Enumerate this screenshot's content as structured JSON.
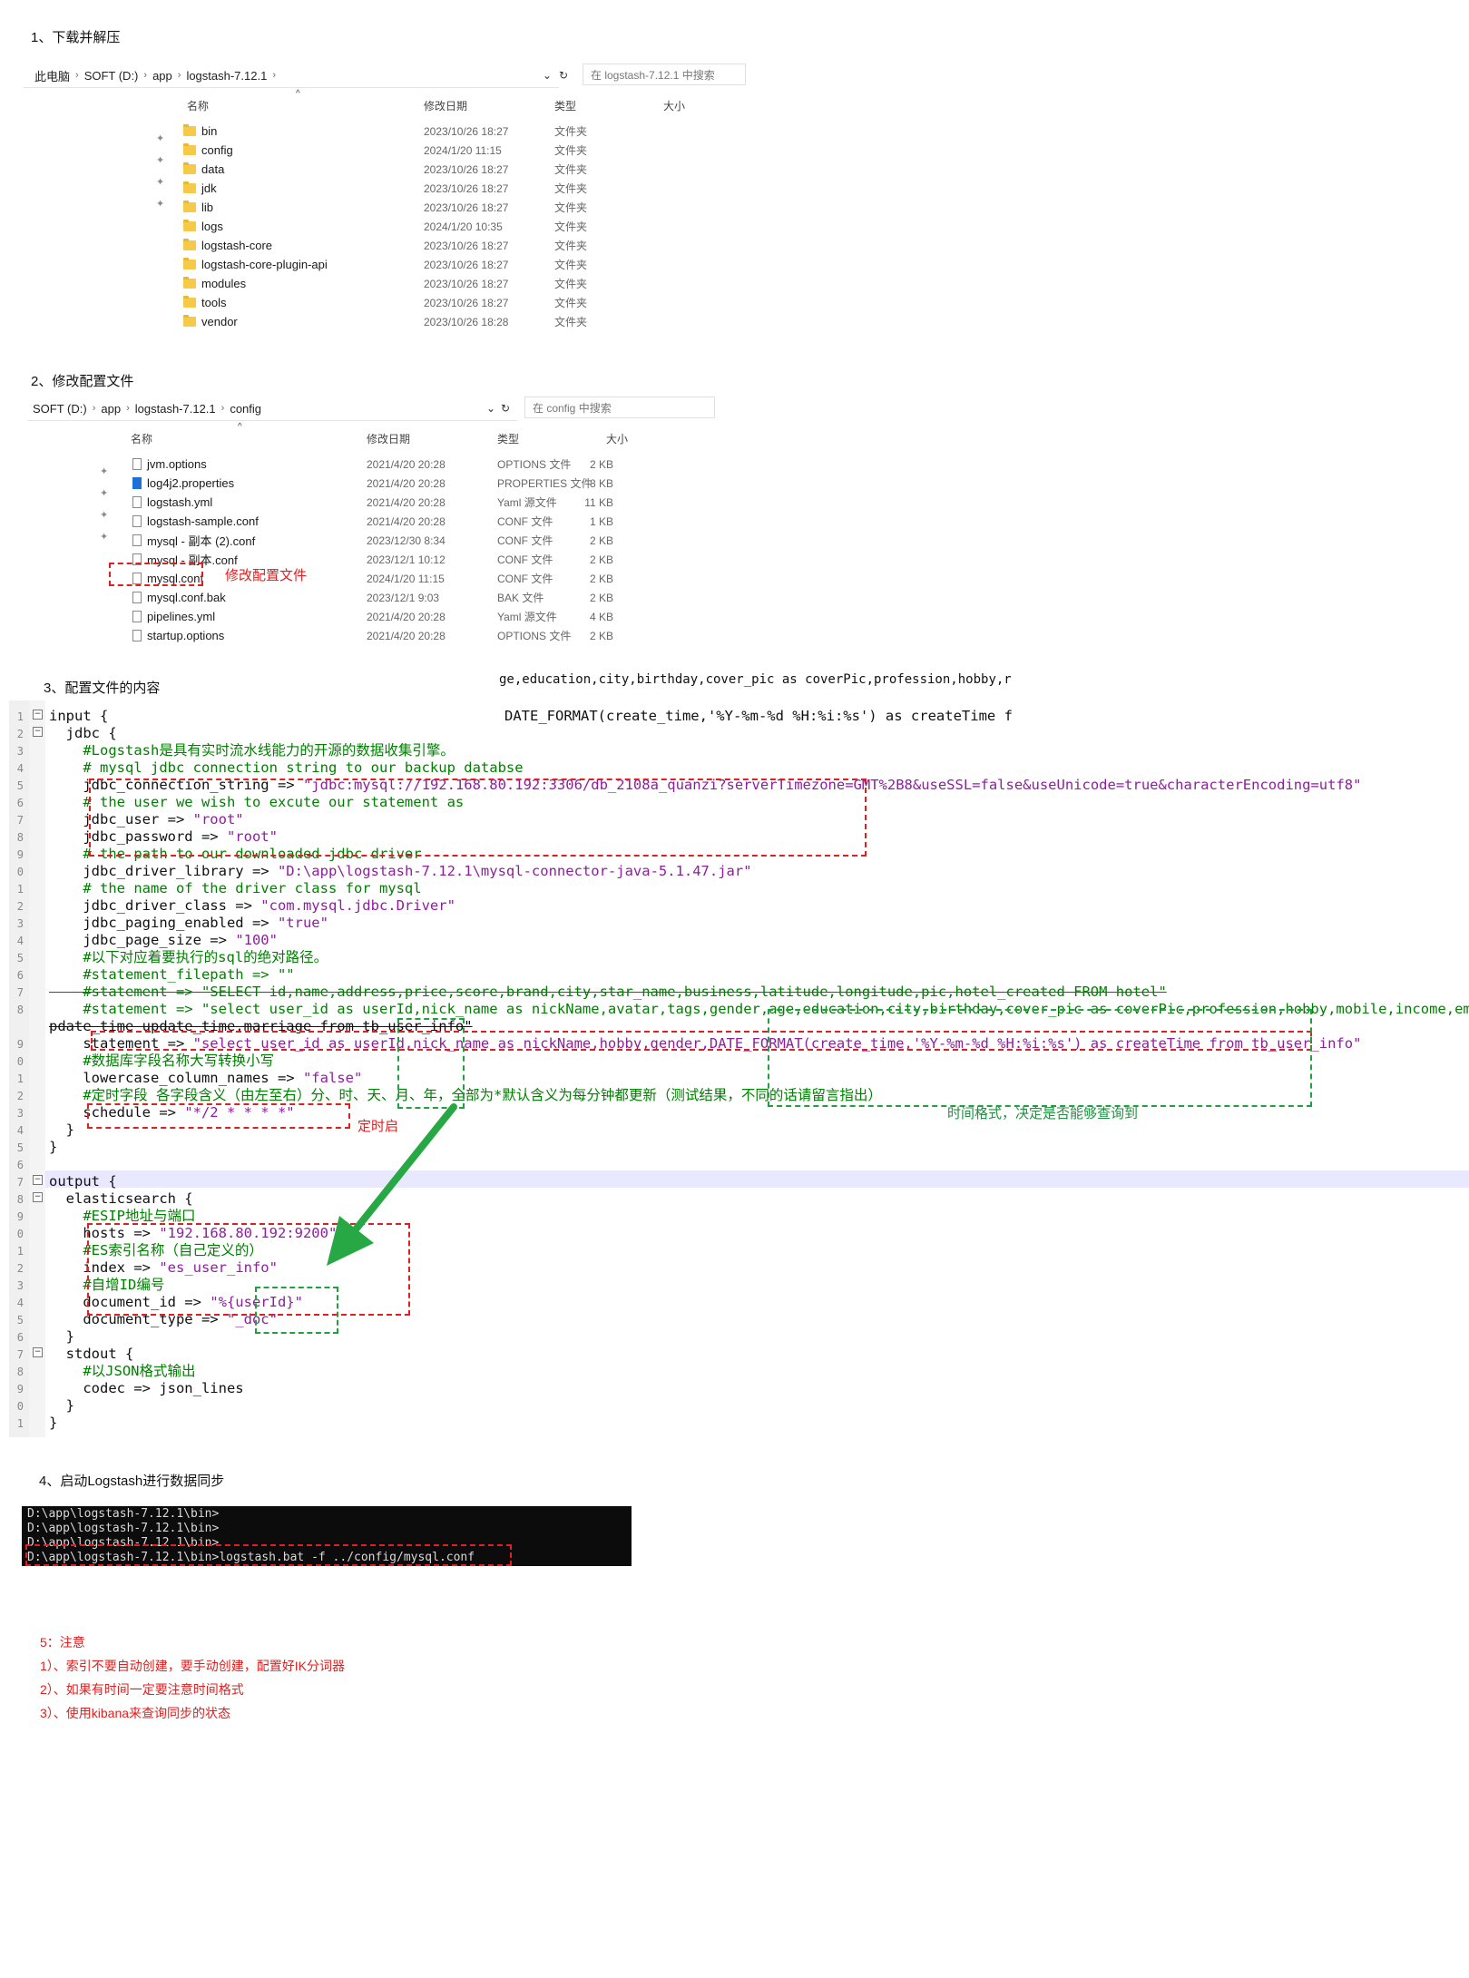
{
  "step1": {
    "heading": "1、下载并解压",
    "breadcrumb": [
      "此电脑",
      "SOFT (D:)",
      "app",
      "logstash-7.12.1"
    ],
    "search_placeholder": "在 logstash-7.12.1 中搜索",
    "columns": {
      "name": "名称",
      "date": "修改日期",
      "type": "类型",
      "size": "大小"
    },
    "rows": [
      {
        "name": "bin",
        "date": "2023/10/26 18:27",
        "type": "文件夹"
      },
      {
        "name": "config",
        "date": "2024/1/20 11:15",
        "type": "文件夹"
      },
      {
        "name": "data",
        "date": "2023/10/26 18:27",
        "type": "文件夹"
      },
      {
        "name": "jdk",
        "date": "2023/10/26 18:27",
        "type": "文件夹"
      },
      {
        "name": "lib",
        "date": "2023/10/26 18:27",
        "type": "文件夹"
      },
      {
        "name": "logs",
        "date": "2024/1/20 10:35",
        "type": "文件夹"
      },
      {
        "name": "logstash-core",
        "date": "2023/10/26 18:27",
        "type": "文件夹"
      },
      {
        "name": "logstash-core-plugin-api",
        "date": "2023/10/26 18:27",
        "type": "文件夹"
      },
      {
        "name": "modules",
        "date": "2023/10/26 18:27",
        "type": "文件夹"
      },
      {
        "name": "tools",
        "date": "2023/10/26 18:27",
        "type": "文件夹"
      },
      {
        "name": "vendor",
        "date": "2023/10/26 18:28",
        "type": "文件夹"
      }
    ]
  },
  "step2": {
    "heading": "2、修改配置文件",
    "breadcrumb": [
      "SOFT (D:)",
      "app",
      "logstash-7.12.1",
      "config"
    ],
    "search_placeholder": "在 config 中搜索",
    "columns": {
      "name": "名称",
      "date": "修改日期",
      "type": "类型",
      "size": "大小"
    },
    "rows": [
      {
        "name": "jvm.options",
        "date": "2021/4/20 20:28",
        "type": "OPTIONS 文件",
        "size": "2 KB",
        "icon": "file"
      },
      {
        "name": "log4j2.properties",
        "date": "2021/4/20 20:28",
        "type": "PROPERTIES 文件",
        "size": "8 KB",
        "icon": "xml"
      },
      {
        "name": "logstash.yml",
        "date": "2021/4/20 20:28",
        "type": "Yaml 源文件",
        "size": "11 KB",
        "icon": "file"
      },
      {
        "name": "logstash-sample.conf",
        "date": "2021/4/20 20:28",
        "type": "CONF 文件",
        "size": "1 KB",
        "icon": "file"
      },
      {
        "name": "mysql - 副本 (2).conf",
        "date": "2023/12/30 8:34",
        "type": "CONF 文件",
        "size": "2 KB",
        "icon": "file"
      },
      {
        "name": "mysql - 副本.conf",
        "date": "2023/12/1 10:12",
        "type": "CONF 文件",
        "size": "2 KB",
        "icon": "file"
      },
      {
        "name": "mysql.conf",
        "date": "2024/1/20 11:15",
        "type": "CONF 文件",
        "size": "2 KB",
        "icon": "file"
      },
      {
        "name": "mysql.conf.bak",
        "date": "2023/12/1 9:03",
        "type": "BAK 文件",
        "size": "2 KB",
        "icon": "file"
      },
      {
        "name": "pipelines.yml",
        "date": "2021/4/20 20:28",
        "type": "Yaml 源文件",
        "size": "4 KB",
        "icon": "file"
      },
      {
        "name": "startup.options",
        "date": "2021/4/20 20:28",
        "type": "OPTIONS 文件",
        "size": "2 KB",
        "icon": "file"
      }
    ],
    "annotation": "修改配置文件"
  },
  "step3": {
    "heading": "3、配置文件的内容",
    "top_overflow": "ge,education,city,birthday,cover_pic as coverPic,profession,hobby,r",
    "top_overflow2": "DATE_FORMAT(create_time,'%Y-%m-%d %H:%i:%s') as createTime f",
    "line_numbers": [
      "1",
      "2",
      "3",
      "4",
      "5",
      "6",
      "7",
      "8",
      "9",
      "0",
      "1",
      "2",
      "3",
      "4",
      "5",
      "6",
      "7",
      "8",
      "",
      "9",
      "0",
      "1",
      "2",
      "3",
      "4",
      "5",
      "6",
      "7",
      "8",
      "9",
      "0",
      "1",
      "2",
      "3",
      "4",
      "5",
      "6",
      "7",
      "8",
      "9",
      "0",
      "1"
    ],
    "lines": [
      "input {",
      "  jdbc {",
      "    #Logstash是具有实时流水线能力的开源的数据收集引擎。",
      "    # mysql jdbc connection string to our backup databse",
      "    jdbc_connection_string => \"jdbc:mysql://192.168.80.192:3306/db_2108a_quanzi?serverTimezone=GMT%2B8&useSSL=false&useUnicode=true&characterEncoding=utf8\"",
      "    # the user we wish to excute our statement as",
      "    jdbc_user => \"root\"",
      "    jdbc_password => \"root\"",
      "    # the path to our downloaded jdbc driver",
      "    jdbc_driver_library => \"D:\\app\\logstash-7.12.1\\mysql-connector-java-5.1.47.jar\"",
      "    # the name of the driver class for mysql",
      "    jdbc_driver_class => \"com.mysql.jdbc.Driver\"",
      "    jdbc_paging_enabled => \"true\"",
      "    jdbc_page_size => \"100\"",
      "    #以下对应着要执行的sql的绝对路径。",
      "    #statement_filepath => \"\"",
      "    #statement => \"SELECT id,name,address,price,score,brand,city,star_name,business,latitude,longitude,pic,hotel_created FROM hotel\"",
      "    #statement => \"select user_id as userId,nick_name as nickName,avatar,tags,gender,age,education,city,birthday,cover_pic as coverPic,profession,hobby,mobile,income,email,u",
      "pdate_time update_time,marriage from tb_user_info\"",
      "    statement => \"select user_id as userId,nick_name as nickName,hobby,gender,DATE_FORMAT(create_time,'%Y-%m-%d %H:%i:%s') as createTime from tb_user_info\"",
      "    #数据库字段名称大写转换小写",
      "    lowercase_column_names => \"false\"",
      "    #定时字段 各字段含义（由左至右）分、时、天、月、年，全部为*默认含义为每分钟都更新（测试结果，不同的话请留言指出）",
      "    schedule => \"*/2 * * * *\"",
      "  }",
      "}",
      "",
      "output {",
      "  elasticsearch {",
      "    #ESIP地址与端口",
      "    hosts => \"192.168.80.192:9200\"",
      "    #ES索引名称（自己定义的）",
      "    index => \"es_user_info\"",
      "    #自增ID编号",
      "    document_id => \"%{userId}\"",
      "    document_type => \"_doc\"",
      "  }",
      "  stdout {",
      "    #以JSON格式输出",
      "    codec => json_lines",
      "  }",
      "}"
    ],
    "annot_schedule": "定时启",
    "annot_time": "时间格式，决定是否能够查询到"
  },
  "step4": {
    "heading": "4、启动Logstash进行数据同步",
    "terminal_lines": [
      "D:\\app\\logstash-7.12.1\\bin>",
      "D:\\app\\logstash-7.12.1\\bin>",
      "D:\\app\\logstash-7.12.1\\bin>",
      "D:\\app\\logstash-7.12.1\\bin>logstash.bat -f ../config/mysql.conf"
    ]
  },
  "notes": {
    "title": "5：注意",
    "items": [
      "1）、索引不要自动创建，要手动创建，配置好IK分词器",
      "2）、如果有时间一定要注意时间格式",
      "3）、使用kibana来查询同步的状态"
    ]
  }
}
